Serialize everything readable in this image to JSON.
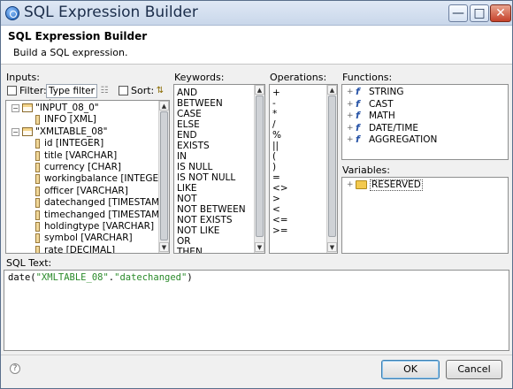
{
  "window": {
    "title": "SQL Expression Builder"
  },
  "header": {
    "title": "SQL Expression Builder",
    "subtitle": "Build a SQL expression."
  },
  "inputs": {
    "label": "Inputs:",
    "filter_label": "Filter:",
    "filter_value": "Type filter te",
    "sort_label": "Sort:",
    "tree": [
      {
        "label": "\"INPUT_08_0\"",
        "level": 0,
        "type": "table",
        "expanded": true
      },
      {
        "label": "INFO [XML]",
        "level": 1,
        "type": "column"
      },
      {
        "label": "\"XMLTABLE_08\"",
        "level": 0,
        "type": "table",
        "expanded": true
      },
      {
        "label": "id [INTEGER]",
        "level": 1,
        "type": "column"
      },
      {
        "label": "title [VARCHAR]",
        "level": 1,
        "type": "column"
      },
      {
        "label": "currency [CHAR]",
        "level": 1,
        "type": "column"
      },
      {
        "label": "workingbalance [INTEGER]",
        "level": 1,
        "type": "column"
      },
      {
        "label": "officer [VARCHAR]",
        "level": 1,
        "type": "column"
      },
      {
        "label": "datechanged [TIMESTAMP]",
        "level": 1,
        "type": "column"
      },
      {
        "label": "timechanged [TIMESTAMP]",
        "level": 1,
        "type": "column"
      },
      {
        "label": "holdingtype [VARCHAR]",
        "level": 1,
        "type": "column"
      },
      {
        "label": "symbol [VARCHAR]",
        "level": 1,
        "type": "column"
      },
      {
        "label": "rate [DECIMAL]",
        "level": 1,
        "type": "column"
      }
    ]
  },
  "keywords": {
    "label": "Keywords:",
    "items": [
      "AND",
      "BETWEEN",
      "CASE",
      "ELSE",
      "END",
      "EXISTS",
      "IN",
      "IS NULL",
      "IS NOT NULL",
      "LIKE",
      "NOT",
      "NOT BETWEEN",
      "NOT EXISTS",
      "NOT LIKE",
      "OR",
      "THEN"
    ]
  },
  "operations": {
    "label": "Operations:",
    "items": [
      "+",
      "-",
      "*",
      "/",
      "%",
      "||",
      "(",
      ")",
      "=",
      "<>",
      ">",
      "<",
      "<=",
      ">="
    ]
  },
  "functions": {
    "label": "Functions:",
    "items": [
      "STRING",
      "CAST",
      "MATH",
      "DATE/TIME",
      "AGGREGATION"
    ]
  },
  "variables": {
    "label": "Variables:",
    "items": [
      "RESERVED"
    ]
  },
  "sql": {
    "label": "SQL Text:",
    "func": "date(",
    "arg_table": "\"XMLTABLE_08\"",
    "dot": ".",
    "arg_col": "\"datechanged\"",
    "close": ")"
  },
  "buttons": {
    "ok": "OK",
    "cancel": "Cancel"
  },
  "icons": {
    "help": "?",
    "minimize": "minimize-icon",
    "maximize": "maximize-icon",
    "close": "close-icon"
  },
  "colors": {
    "sql_string": "#2a8a2a",
    "selection_border": "#3c7fb1"
  }
}
